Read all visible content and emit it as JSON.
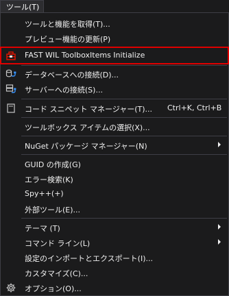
{
  "menu": {
    "title": "ツール(T)"
  },
  "items": [
    {
      "label": "ツールと機能を取得(T)..."
    },
    {
      "label": "プレビュー機能の更新(P)"
    },
    {
      "label": "FAST WIL ToolboxItems Initialize",
      "icon": "toolbox-icon"
    },
    {
      "label": "データベースへの接続(D)...",
      "icon": "database-connect-icon"
    },
    {
      "label": "サーバーへの接続(S)...",
      "icon": "server-connect-icon"
    },
    {
      "label": "コード スニペット マネージャー(T)...",
      "icon": "snippet-icon",
      "shortcut": "Ctrl+K, Ctrl+B"
    },
    {
      "label": "ツールボックス アイテムの選択(X)..."
    },
    {
      "label": "NuGet パッケージ マネージャー(N)",
      "submenu": true
    },
    {
      "label": "GUID の作成(G)"
    },
    {
      "label": "エラー検索(K)"
    },
    {
      "label": "Spy++(+)"
    },
    {
      "label": "外部ツール(E)..."
    },
    {
      "label": "テーマ (T)",
      "submenu": true
    },
    {
      "label": "コマンド ライン(L)",
      "submenu": true
    },
    {
      "label": "設定のインポートとエクスポート(I)..."
    },
    {
      "label": "カスタマイズ(C)..."
    },
    {
      "label": "オプション(O)...",
      "icon": "gear-icon"
    }
  ],
  "colors": {
    "background": "#1b1b1c",
    "text": "#f1f1f1",
    "separator": "#3f3f46",
    "highlight_border": "#e00000"
  }
}
